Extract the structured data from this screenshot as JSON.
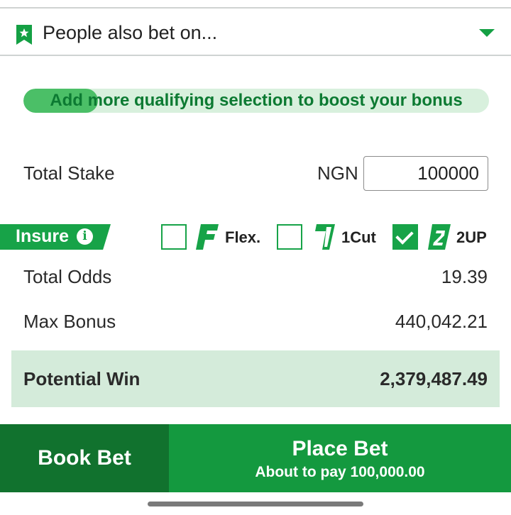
{
  "people_bar": {
    "title": "People also bet on..."
  },
  "boost": {
    "text": "Add more qualifying selection to boost your bonus",
    "progress": 0.16
  },
  "stake": {
    "label": "Total Stake",
    "currency": "NGN",
    "value": "100000"
  },
  "insure": {
    "label": "Insure",
    "options": [
      {
        "label": "Flex.",
        "checked": false,
        "icon": "flex-f-icon"
      },
      {
        "label": "1Cut",
        "checked": false,
        "icon": "one-cut-icon"
      },
      {
        "label": "2UP",
        "checked": true,
        "icon": "two-up-icon"
      }
    ]
  },
  "summary": {
    "odds_label": "Total Odds",
    "odds_value": "19.39",
    "bonus_label": "Max Bonus",
    "bonus_value": "440,042.21",
    "win_label": "Potential Win",
    "win_value": "2,379,487.49"
  },
  "actions": {
    "book_label": "Book Bet",
    "place_label": "Place Bet",
    "pay_text": "About to pay 100,000.00"
  },
  "colors": {
    "brand_green": "#14993f",
    "dark_green": "#11722e",
    "light_green": "#d4ebda"
  }
}
